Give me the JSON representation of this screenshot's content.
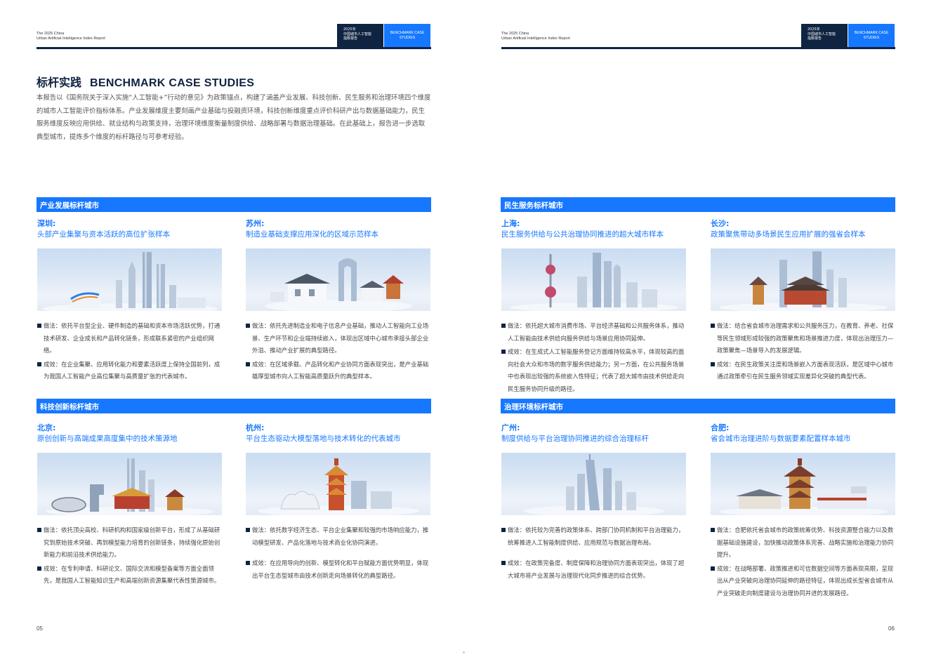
{
  "header": {
    "report_en_line1": "The 2025 China",
    "report_en_line2": "Urban Artificial Intelligence Index Report",
    "badge_cn_line1": "2025年",
    "badge_cn_line2": "中国城市人工智能",
    "badge_cn_line3": "指数报告",
    "badge_en_line1": "BENCHMARK CASE",
    "badge_en_line2": "STUDIES"
  },
  "intro": {
    "title_cn": "标杆实践",
    "title_en": "BENCHMARK CASE STUDIES",
    "body": "本报告以《国务院关于深入实施“人工智能+”行动的意见》为政策锚点，构建了涵盖产业发展、科技创新、民生服务和治理环境四个维度的城市人工智能评价指标体系。产业发展维度主要刻画产业基础与投融资环境，科技创新维度重点评价科研产出与数据基础能力，民生服务维度反映应用供给、就业结构与政策支持，治理环境维度衡量制度供给、战略部署与数据治理基础。在此基础上，报告进一步选取典型城市，提炼多个维度的标杆路径与可参考经验。"
  },
  "sections": {
    "industry": {
      "title": "产业发展标杆城市",
      "shenzhen": {
        "name": "深圳:",
        "subtitle": "头部产业集聚与资本活跃的高位扩张样本",
        "bullet1": "做法：依托平台型企业、硬件制造的基础和资本市场活跃优势，打通技术研发、企业成长和产品转化链条，形成联系紧密的产业组织网络。",
        "bullet2": "成效：在企业集聚、应用转化能力和要素活跃度上保持全国前列，成为我国人工智能产业高位集聚与高质量扩张的代表城市。"
      },
      "suzhou": {
        "name": "苏州:",
        "subtitle": "制造业基础支撑应用深化的区域示范样本",
        "bullet1": "做法：依托先进制造业和电子信息产业基础，推动人工智能向工业场景、生产环节和企业端持续嵌入，体现出区域中心城市承接头部企业外溢、推动产业扩展的典型路径。",
        "bullet2": "成效：在区域承载、产品转化和产业协同方面表现突出，是产业基础雄厚型城市向人工智能高质量跃升的典型样本。"
      }
    },
    "tech": {
      "title": "科技创新标杆城市",
      "beijing": {
        "name": "北京:",
        "subtitle": "原创创新与高端成果高度集中的技术策源地",
        "bullet1": "做法：依托顶尖高校、科研机构和国家级创新平台，形成了从基础研究到原始技术突破、再到模型能力培育的创新链条，持续强化原始创新能力和前沿技术供给能力。",
        "bullet2": "成效：在专利申请、科研论文、国际交流和模型备案等方面全面领先，是我国人工智能知识生产和高端创新资源集聚代表性策源城市。"
      },
      "hangzhou": {
        "name": "杭州:",
        "subtitle": "平台生态驱动大模型落地与技术转化的代表城市",
        "bullet1": "做法：依托数字经济生态、平台企业集聚和较强的市场响应能力，推动模型研发、产品化落地与技术商业化协同演进。",
        "bullet2": "成效：在应用导向的创新、模型转化和平台赋能方面优势明显，体现出平台生态型城市由技术创新走向场景转化的典型路径。"
      }
    },
    "livelihood": {
      "title": "民生服务标杆城市",
      "shanghai": {
        "name": "上海:",
        "subtitle": "民生服务供给与公共治理协同推进的超大城市样本",
        "bullet1": "做法：依托超大城市消费市场、平台经济基础和公共服务体系，推动人工智能由技术供给向服务供给与场景应用协同延伸。",
        "bullet2": "成效：在生成式人工智能服务登记方面维持较高水平，体现较高的面向社会大众和市场的数字服务供给能力；另一方面，在公共服务场景中也表现出较强的系统嵌入性特征；代表了超大城市由技术供给走向民生服务协同升级的路径。"
      },
      "changsha": {
        "name": "长沙:",
        "subtitle": "政策聚焦带动多场景民生应用扩展的强省会样本",
        "bullet1": "做法：结合省会城市治理需求和公共服务压力，在教育、养老、社保等民生领域形成较强的政策聚焦和场景推进力度，体现出治理压力—政策聚焦—场景导入的发展逻辑。",
        "bullet2": "成效：在民生政策关注度和场景嵌入方面表现活跃，是区域中心城市通过政策牵引在民生服务领域实现差异化突破的典型代表。"
      }
    },
    "governance": {
      "title": "治理环境标杆城市",
      "guangzhou": {
        "name": "广州:",
        "subtitle": "制度供给与平台治理协同推进的综合治理标杆",
        "bullet1": "做法：依托较为完善的政策体系、跨部门协同机制和平台治理能力，统筹推进人工智能制度供给、应用规范与数据治理布局。",
        "bullet2": "成效：在政策完备度、制度保障和治理协同方面表现突出，体现了超大城市将产业发展与治理现代化同步推进的综合优势。"
      },
      "hefei": {
        "name": "合肥:",
        "subtitle": "省会城市治理进阶与数据要素配置样本城市",
        "bullet1": "做法：合肥依托省会城市的政策统筹优势、科技资源整合能力以及数据基础设施建设，加快推动政策体系完善、战略实施和治理能力协同提升。",
        "bullet2": "成效：在战略部署、政策推进和可信数据空间等方面表现亮眼，呈现出从产业突破向治理协同延伸的路径特征，体现出成长型省会城市从产业突破走向制度建设与治理协同并进的发展路径。"
      }
    }
  },
  "pages": {
    "left_number": "05",
    "right_number": "06"
  },
  "colors": {
    "navy": "#0f2342",
    "accent_blue": "#1677ff"
  },
  "icons": {
    "bullet": "square-bullet-icon"
  }
}
